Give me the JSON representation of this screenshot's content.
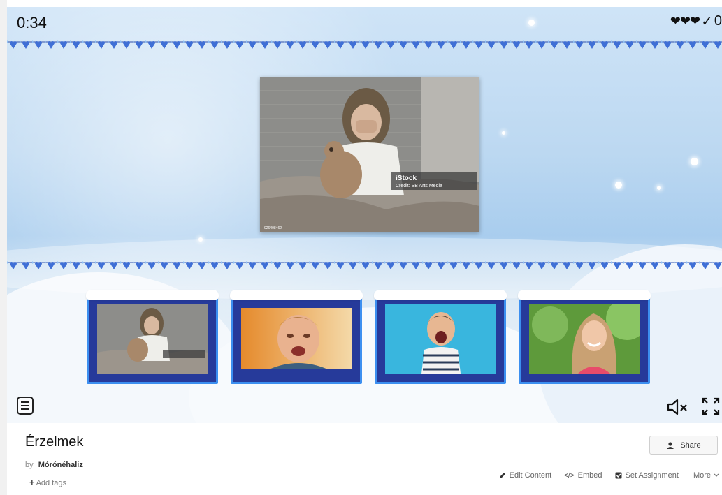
{
  "hud": {
    "timer": "0:34",
    "hearts": "❤❤❤",
    "check": "✓",
    "score": "0"
  },
  "question_image": {
    "watermark_brand": "iStock",
    "watermark_credit": "Credit: SB Arts Media",
    "watermark_id": "926408462"
  },
  "activity": {
    "title": "Érzelmek",
    "by_label": "by",
    "author": "Mórónéhaliz",
    "add_tags": "Add tags",
    "share": "Share"
  },
  "actions": {
    "edit_content": "Edit Content",
    "embed": "Embed",
    "set_assignment": "Set Assignment",
    "more": "More"
  }
}
